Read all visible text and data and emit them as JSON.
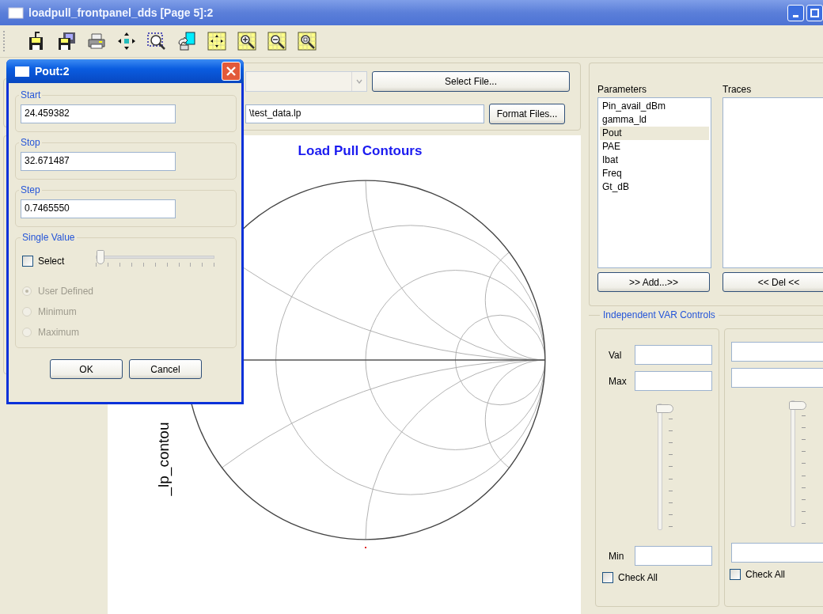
{
  "window": {
    "title": "loadpull_frontpanel_dds [Page 5]:2"
  },
  "file_panel": {
    "select_button": "Select File...",
    "path": "\\test_data.lp",
    "format_button": "Format Files..."
  },
  "chart": {
    "title": "Load Pull Contours",
    "ylabel": "_lp_contou"
  },
  "parameters": {
    "label": "Parameters",
    "items": [
      {
        "label": "Pin_avail_dBm",
        "selected": false
      },
      {
        "label": "gamma_ld",
        "selected": false
      },
      {
        "label": "Pout",
        "selected": true
      },
      {
        "label": "PAE",
        "selected": false
      },
      {
        "label": "Ibat",
        "selected": false
      },
      {
        "label": "Freq",
        "selected": false
      },
      {
        "label": "Gt_dB",
        "selected": false
      }
    ]
  },
  "traces": {
    "label": "Traces"
  },
  "add_button": ">> Add...>>",
  "del_button": "<< Del <<",
  "var_controls": {
    "title": "Independent VAR Controls",
    "columns": [
      {
        "val_label": "Val",
        "max_label": "Max",
        "min_label": "Min",
        "level": 1,
        "check_all": {
          "label": "Check All",
          "checked": false
        }
      },
      {
        "level": 1,
        "check_all": {
          "label": "Check All",
          "checked": false
        }
      }
    ]
  },
  "dialog": {
    "title": "Pout:2",
    "fields": [
      {
        "label": "Start",
        "value": "24.459382"
      },
      {
        "label": "Stop",
        "value": "32.671487"
      },
      {
        "label": "Step",
        "value": "0.7465550"
      }
    ],
    "single_value": {
      "title": "Single Value",
      "select": {
        "label": "Select",
        "checked": false
      },
      "level": 0,
      "options": [
        {
          "label": "User Defined",
          "selected": true,
          "disabled": true
        },
        {
          "label": "Minimum",
          "selected": false,
          "disabled": true
        },
        {
          "label": "Maximum",
          "selected": false,
          "disabled": true
        }
      ]
    },
    "buttons": [
      "OK",
      "Cancel"
    ]
  }
}
